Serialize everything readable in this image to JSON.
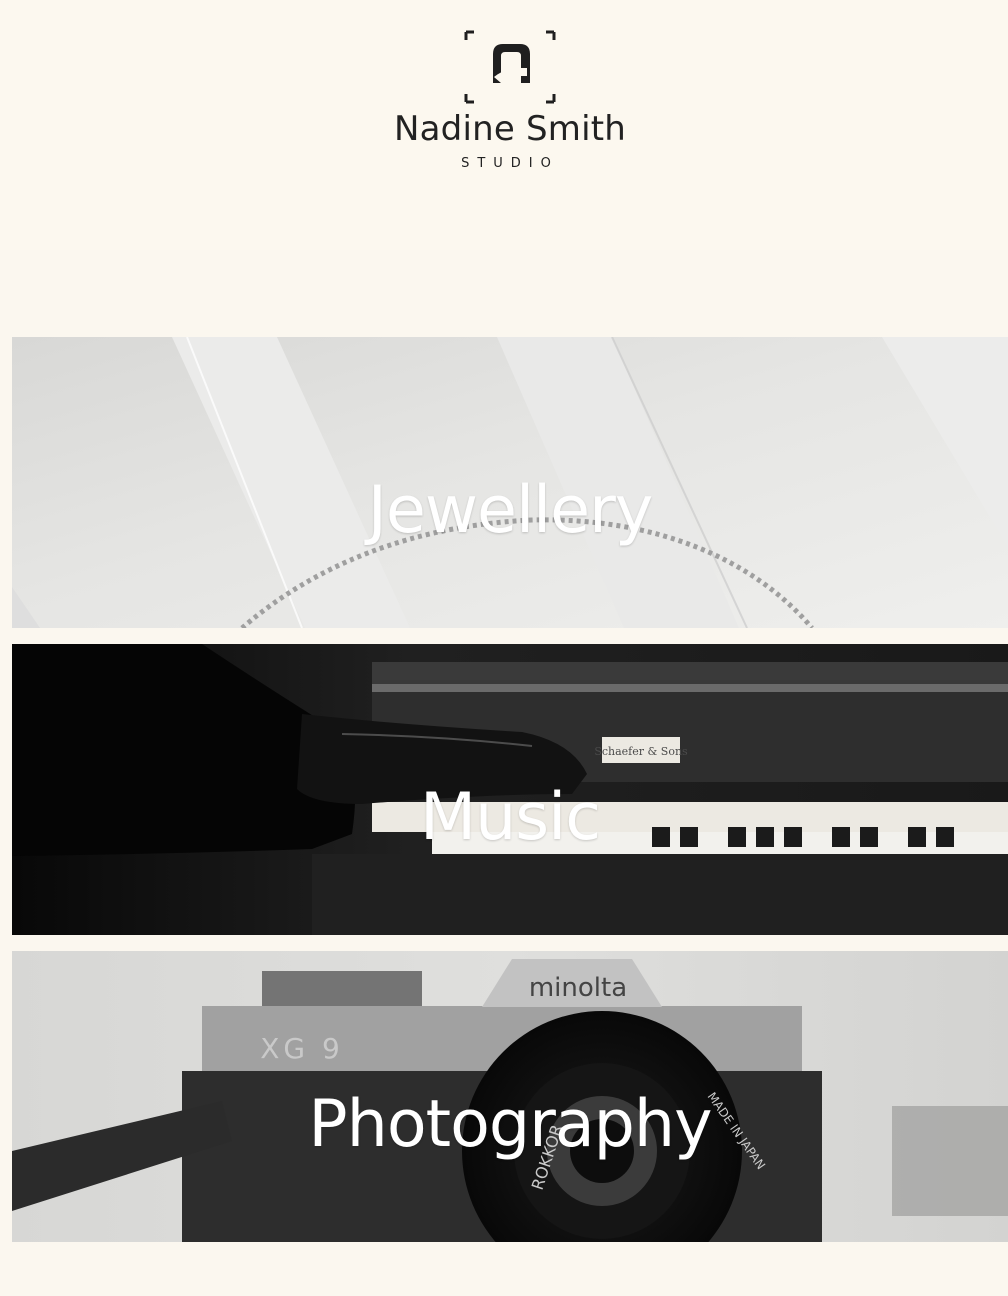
{
  "brand": {
    "name": "Nadine Smith",
    "subtitle": "STUDIO"
  },
  "sections": [
    {
      "label": "Jewellery"
    },
    {
      "label": "Music"
    },
    {
      "label": "Photography"
    }
  ],
  "photo_text": {
    "piano_brand": "Schaefer & Sons",
    "camera_brand": "minolta",
    "camera_model": "XG 9",
    "lens_brand": "ROKKOR",
    "lens_text": "MADE IN JAPAN"
  },
  "colors": {
    "background": "#fbf7ef",
    "text_dark": "#222222",
    "label_text": "#ffffff"
  },
  "icons": {
    "logo": "ns-monogram-icon"
  }
}
